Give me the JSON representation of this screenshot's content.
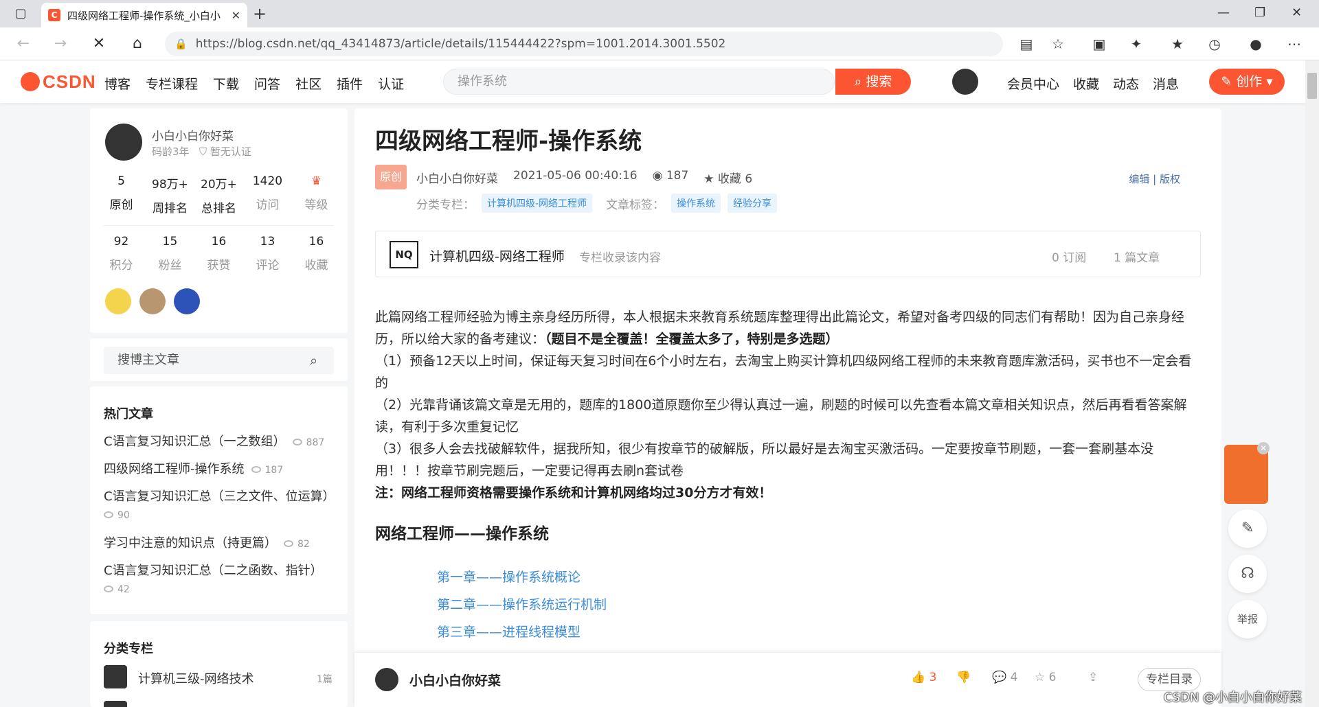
{
  "browser": {
    "tab_title": "四级网络工程师-操作系统_小白小",
    "tab_favicon": "C",
    "url": "https://blog.csdn.net/qq_43414873/article/details/115444422?spm=1001.2014.3001.5502"
  },
  "header": {
    "logo": "CSDN",
    "nav": [
      "博客",
      "专栏课程",
      "下载",
      "问答",
      "社区",
      "插件",
      "认证"
    ],
    "search_placeholder": "操作系统",
    "search_button": "搜索",
    "right_nav": [
      "会员中心",
      "收藏",
      "动态",
      "消息"
    ],
    "create_button": "创作"
  },
  "profile": {
    "name": "小白小白你好菜",
    "years": "码龄3年",
    "cert": "暂无认证",
    "stats1": [
      {
        "value": "5",
        "label": "原创"
      },
      {
        "value": "98万+",
        "label": "周排名"
      },
      {
        "value": "20万+",
        "label": "总排名"
      },
      {
        "value": "1420",
        "label": "访问"
      },
      {
        "value": "",
        "label": "等级"
      }
    ],
    "stats2": [
      {
        "value": "92",
        "label": "积分"
      },
      {
        "value": "15",
        "label": "粉丝"
      },
      {
        "value": "16",
        "label": "获赞"
      },
      {
        "value": "13",
        "label": "评论"
      },
      {
        "value": "16",
        "label": "收藏"
      }
    ]
  },
  "sidebar_search": {
    "placeholder": "搜博主文章"
  },
  "hot": {
    "title": "热门文章",
    "items": [
      {
        "title": "C语言复习知识汇总（一之数组）",
        "views": "887"
      },
      {
        "title": "四级网络工程师-操作系统",
        "views": "187"
      },
      {
        "title": "C语言复习知识汇总（三之文件、位运算）",
        "views": "90"
      },
      {
        "title": "学习中注意的知识点（持更篇）",
        "views": "82"
      },
      {
        "title": "C语言复习知识汇总（二之函数、指针）",
        "views": "42"
      }
    ]
  },
  "category": {
    "title": "分类专栏",
    "items": [
      {
        "name": "计算机三级-网络技术",
        "count": "1篇"
      }
    ]
  },
  "article": {
    "title": "四级网络工程师-操作系统",
    "badge": "原创",
    "author": "小白小白你好菜",
    "date": "2021-05-06 00:40:16",
    "views": "187",
    "favorites": "收藏 6",
    "edit": "编辑",
    "copyright": "版权",
    "cat_label": "分类专栏：",
    "cat_tag": "计算机四级-网络工程师",
    "tag_label": "文章标签：",
    "tags": [
      "操作系统",
      "经验分享"
    ],
    "column": {
      "name": "计算机四级-网络工程师",
      "desc": "专栏收录该内容",
      "subs": "0 订阅",
      "posts": "1 篇文章",
      "logo": "NQ"
    },
    "para1": "此篇网络工程师经验为博主亲身经历所得，本人根据未来教育系统题库整理得出此篇论文，希望对备考四级的同志们有帮助！因为自己亲身经历，所以给大家的备考建议：",
    "para1_bold": "（题目不是全覆盖！全覆盖太多了，特别是多选题）",
    "para2": "（1）预备12天以上时间，保证每天复习时间在6个小时左右，去淘宝上购买计算机四级网络工程师的未来教育题库激活码，买书也不一定会看的",
    "para3": "（2）光靠背诵该篇文章是无用的，题库的1800道原题你至少得认真过一遍，刷题的时候可以先查看本篇文章相关知识点，然后再看看答案解读，有利于多次重复记忆",
    "para4": "（3）很多人会去找破解软件，据我所知，很少有按章节的破解版，所以最好是去淘宝买激活码。一定要按章节刷题，一套一套刷基本没用！！！按章节刷完题后，一定要记得再去刷n套试卷",
    "note": "注：网络工程师资格需要操作系统和计算机网络均过30分方才有效！",
    "h2": "网络工程师——操作系统",
    "toc": [
      "第一章——操作系统概论",
      "第二章——操作系统运行机制",
      "第三章——进程线程模型"
    ]
  },
  "bottom": {
    "author": "小白小白你好菜",
    "likes": "3",
    "comments": "4",
    "stars": "6",
    "toc_button": "专栏目录"
  },
  "floats": {
    "report": "举报"
  },
  "watermark": "CSDN @小白小白你好菜",
  "colors": {
    "brand": "#fc5531",
    "link": "#3b8ddb"
  }
}
